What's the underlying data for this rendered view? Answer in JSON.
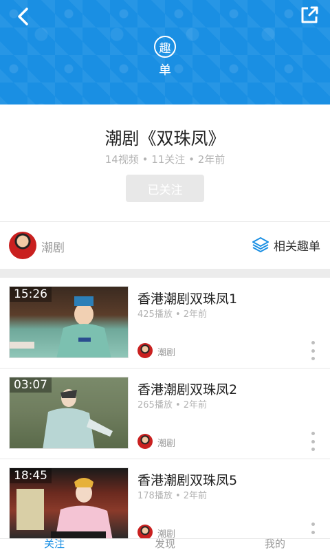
{
  "header": {
    "logo_char": "趣",
    "logo_sub": "单"
  },
  "playlist": {
    "title": "潮剧《双珠凤》",
    "meta": "14视频 • 11关注 • 2年前",
    "follow_label": "已关注"
  },
  "author": {
    "name": "潮剧",
    "related_label": "相关趣单"
  },
  "videos": [
    {
      "duration": "15:26",
      "title": "香港潮剧双珠凤1",
      "meta": "425播放 • 2年前",
      "author": "潮剧"
    },
    {
      "duration": "03:07",
      "title": "香港潮剧双珠凤2",
      "meta": "265播放 • 2年前",
      "author": "潮剧"
    },
    {
      "duration": "18:45",
      "title": "香港潮剧双珠凤5",
      "meta": "178播放 • 2年前",
      "author": "潮剧"
    }
  ],
  "tabs": [
    {
      "label": "关注",
      "active": true
    },
    {
      "label": "发现",
      "active": false
    },
    {
      "label": "我的",
      "active": false
    }
  ],
  "colors": {
    "accent": "#1a8fe3",
    "follow_bg": "#e8e8e8"
  }
}
